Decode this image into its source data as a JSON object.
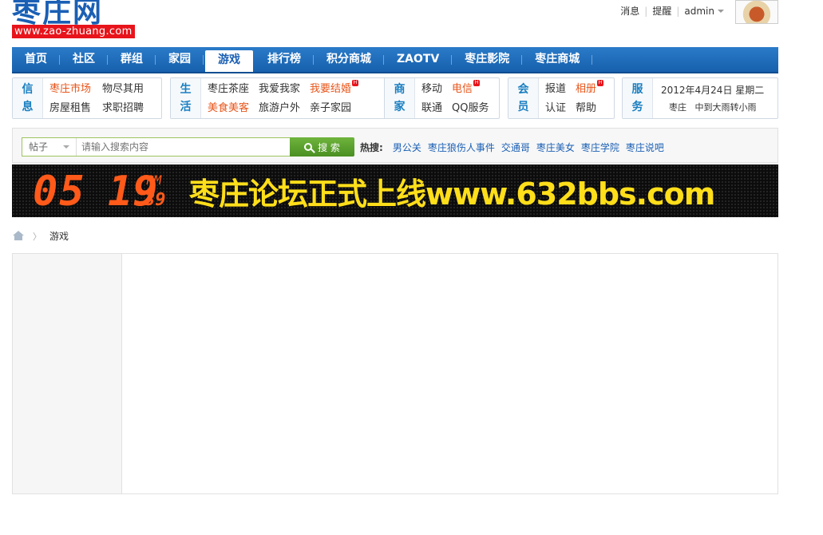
{
  "header": {
    "logo_text": "枣庄网",
    "logo_url": "www.zao-zhuang.com",
    "links": [
      "消息",
      "提醒"
    ],
    "username": "admin"
  },
  "nav": {
    "items": [
      "首页",
      "社区",
      "群组",
      "家园",
      "游戏",
      "排行榜",
      "积分商城",
      "ZAOTV",
      "枣庄影院",
      "枣庄商城"
    ],
    "active_index": 4
  },
  "quick": {
    "info": {
      "label": [
        "信",
        "息"
      ],
      "links": [
        "枣庄市场",
        "物尽其用",
        "房屋租售",
        "求职招聘"
      ]
    },
    "life": {
      "label": [
        "生",
        "活"
      ],
      "links": [
        "枣庄茶座",
        "我爱我家",
        "我要结婚",
        "美食美客",
        "旅游户外",
        "亲子家园"
      ]
    },
    "biz": {
      "label": [
        "商",
        "家"
      ],
      "links": [
        "移动",
        "电信",
        "联通",
        "QQ服务"
      ]
    },
    "member": {
      "label": [
        "会",
        "员"
      ],
      "links": [
        "报道",
        "相册",
        "认证",
        "帮助"
      ]
    },
    "service": {
      "label": [
        "服",
        "务"
      ],
      "date": "2012年4月24日 星期二",
      "city": "枣庄",
      "weather": "中到大雨转小雨"
    }
  },
  "search": {
    "type": "帖子",
    "placeholder": "请输入搜索内容",
    "button": "搜 索",
    "hot_label": "热搜:",
    "hot_terms": [
      "男公关",
      "枣庄狼伤人事件",
      "交通哥",
      "枣庄美女",
      "枣庄学院",
      "枣庄说吧"
    ]
  },
  "banner": {
    "hour": "05",
    "minute": "19",
    "ampm": "PM",
    "second": "39",
    "text": "枣庄论坛正式上线www.632bbs.com"
  },
  "breadcrumb": {
    "current": "游戏"
  },
  "colors": {
    "nav": "#1a6cbb",
    "accent": "#e8551a",
    "link": "#1a5fb4",
    "search_green": "#5ba22f"
  }
}
